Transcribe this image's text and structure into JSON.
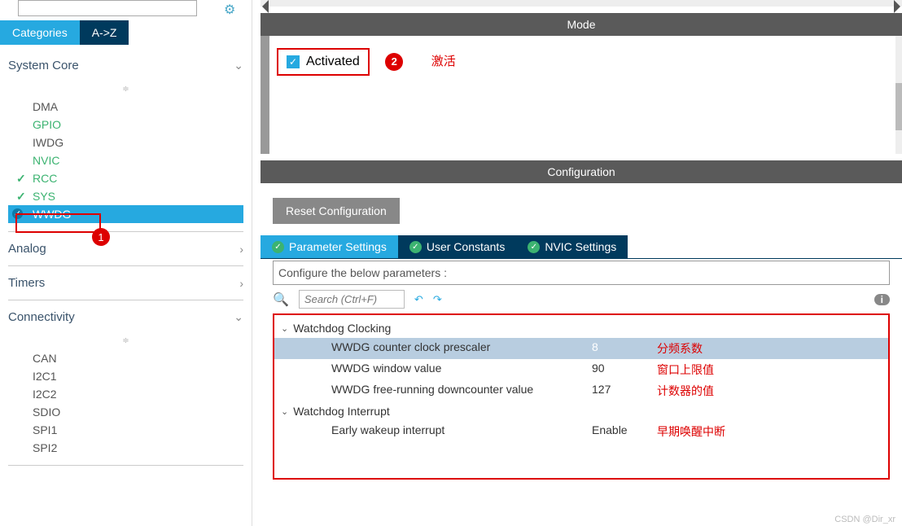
{
  "tabs": {
    "categories": "Categories",
    "az": "A->Z"
  },
  "sections": {
    "system_core": {
      "label": "System Core",
      "items": [
        {
          "label": "DMA",
          "cls": ""
        },
        {
          "label": "GPIO",
          "cls": "green"
        },
        {
          "label": "IWDG",
          "cls": ""
        },
        {
          "label": "NVIC",
          "cls": "green"
        },
        {
          "label": "RCC",
          "cls": "green green-check"
        },
        {
          "label": "SYS",
          "cls": "green green-check"
        },
        {
          "label": "WWDG",
          "cls": "selected"
        }
      ]
    },
    "analog": {
      "label": "Analog"
    },
    "timers": {
      "label": "Timers"
    },
    "connectivity": {
      "label": "Connectivity",
      "items": [
        {
          "label": "CAN"
        },
        {
          "label": "I2C1"
        },
        {
          "label": "I2C2"
        },
        {
          "label": "SDIO"
        },
        {
          "label": "SPI1"
        },
        {
          "label": "SPI2"
        }
      ]
    }
  },
  "mode": {
    "header": "Mode",
    "activated": "Activated",
    "badge": "2",
    "anno": "激活"
  },
  "config": {
    "header": "Configuration",
    "reset": "Reset Configuration",
    "tabs": {
      "param": "Parameter Settings",
      "user": "User Constants",
      "nvic": "NVIC Settings"
    },
    "text": "Configure the below parameters :",
    "search_ph": "Search (Ctrl+F)"
  },
  "params": {
    "g1": "Watchdog Clocking",
    "r1": {
      "l": "WWDG counter clock prescaler",
      "v": "8",
      "a": "分频系数"
    },
    "r2": {
      "l": "WWDG window value",
      "v": "90",
      "a": "窗口上限值"
    },
    "r3": {
      "l": "WWDG free-running downcounter value",
      "v": "127",
      "a": "计数器的值"
    },
    "g2": "Watchdog Interrupt",
    "r4": {
      "l": "Early wakeup interrupt",
      "v": "Enable",
      "a": "早期唤醒中断"
    }
  },
  "badge1": "1",
  "watermark": "CSDN @Dir_xr"
}
